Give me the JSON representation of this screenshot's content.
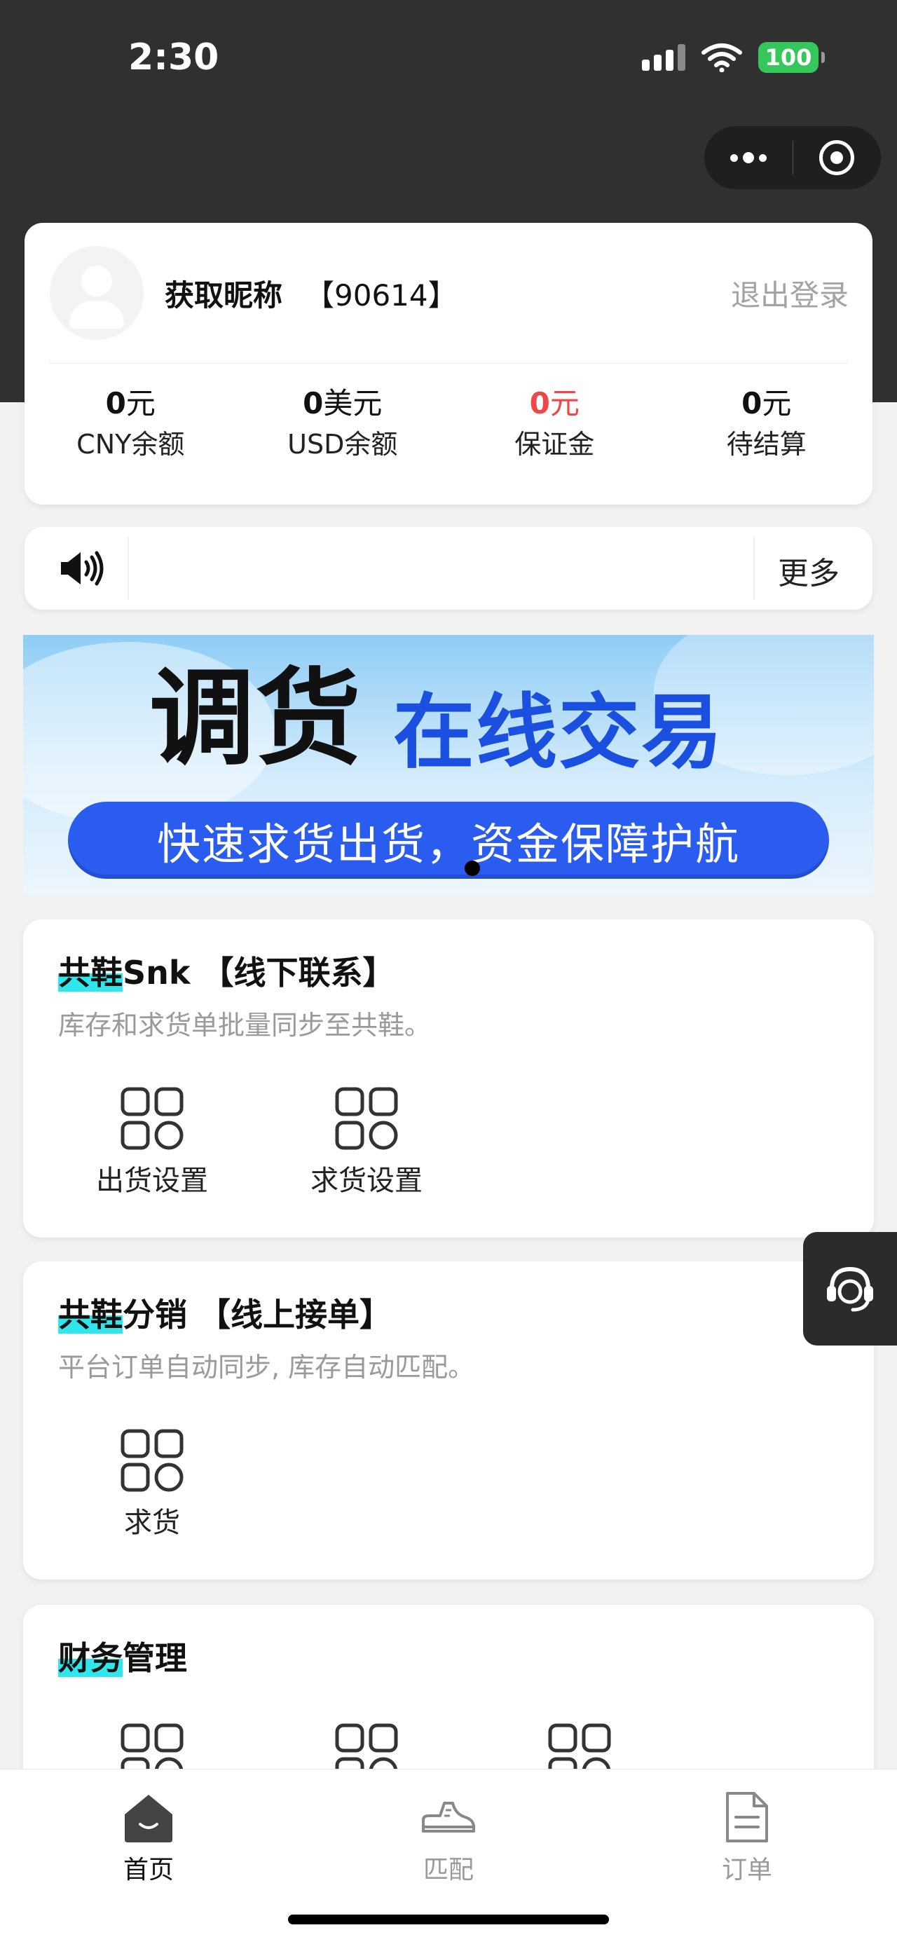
{
  "status_bar": {
    "time": "2:30",
    "battery": "100"
  },
  "profile": {
    "nickname": "获取昵称",
    "user_id": "【90614】",
    "logout_label": "退出登录",
    "balances": [
      {
        "amount": "0",
        "unit": "元",
        "label": "CNY余额",
        "highlight": false
      },
      {
        "amount": "0",
        "unit": "美元",
        "label": "USD余额",
        "highlight": false
      },
      {
        "amount": "0",
        "unit": "元",
        "label": "保证金",
        "highlight": true
      },
      {
        "amount": "0",
        "unit": "元",
        "label": "待结算",
        "highlight": false
      }
    ]
  },
  "notice": {
    "more_label": "更多",
    "icon": "speaker-icon"
  },
  "banner": {
    "title_main": "调货",
    "title_accent": "在线交易",
    "subtitle": "快速求货出货，资金保障护航",
    "accent_color": "#2a5cf0"
  },
  "sections": [
    {
      "title_highlight": "共鞋",
      "title_rest": "Snk 【线下联系】",
      "desc": "库存和求货单批量同步至共鞋。",
      "items": [
        {
          "label": "出货设置"
        },
        {
          "label": "求货设置"
        }
      ]
    },
    {
      "title_highlight": "共鞋",
      "title_rest": "分销 【线上接单】",
      "desc": "平台订单自动同步, 库存自动匹配。",
      "items": [
        {
          "label": "求货"
        }
      ]
    },
    {
      "title_highlight": "财务",
      "title_rest": "管理",
      "desc": "",
      "items": [
        {
          "label": ""
        },
        {
          "label": ""
        },
        {
          "label": ""
        }
      ]
    }
  ],
  "tabbar": {
    "tabs": [
      {
        "label": "首页",
        "icon": "home-icon",
        "active": true
      },
      {
        "label": "匹配",
        "icon": "sneaker-icon",
        "active": false
      },
      {
        "label": "订单",
        "icon": "document-icon",
        "active": false
      }
    ]
  },
  "colors": {
    "highlight": "#2ee6ec",
    "danger": "#ef4747",
    "header_bg": "#303030"
  }
}
